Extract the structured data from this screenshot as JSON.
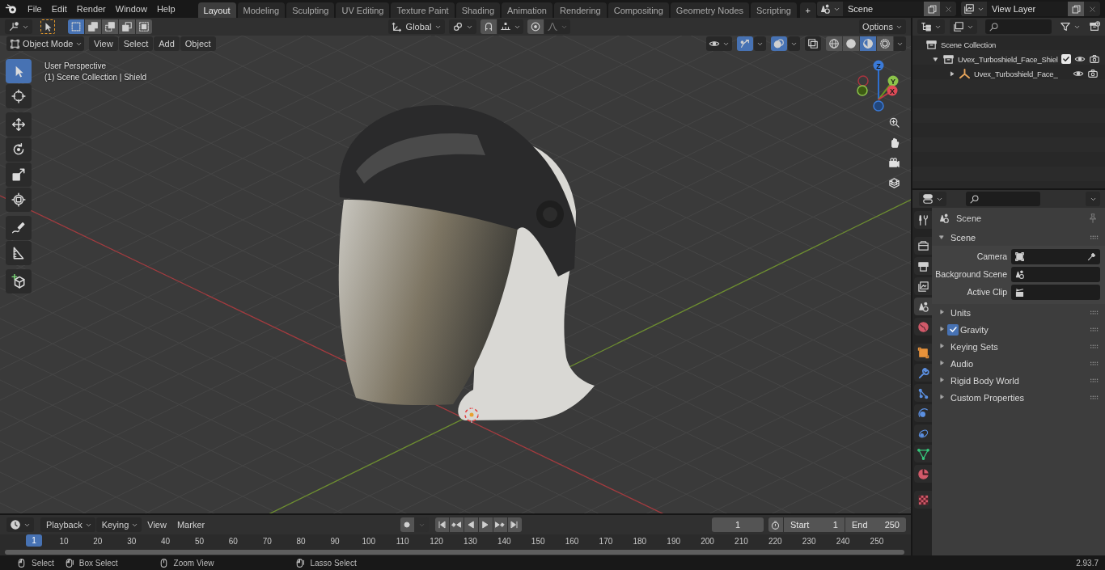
{
  "topbar": {
    "menus": [
      "File",
      "Edit",
      "Render",
      "Window",
      "Help"
    ],
    "workspaces": [
      {
        "label": "Layout",
        "selected": true
      },
      {
        "label": "Modeling",
        "selected": false
      },
      {
        "label": "Sculpting",
        "selected": false
      },
      {
        "label": "UV Editing",
        "selected": false
      },
      {
        "label": "Texture Paint",
        "selected": false
      },
      {
        "label": "Shading",
        "selected": false
      },
      {
        "label": "Animation",
        "selected": false
      },
      {
        "label": "Rendering",
        "selected": false
      },
      {
        "label": "Compositing",
        "selected": false
      },
      {
        "label": "Geometry Nodes",
        "selected": false
      },
      {
        "label": "Scripting",
        "selected": false
      }
    ],
    "add_workspace": "+",
    "scene": "Scene",
    "view_layer": "View Layer"
  },
  "viewport": {
    "header": {
      "selection_modes": [
        {
          "kind": "set",
          "selected": true
        },
        {
          "kind": "extend",
          "selected": false
        },
        {
          "kind": "subtract",
          "selected": false
        },
        {
          "kind": "difference",
          "selected": false
        },
        {
          "kind": "intersect",
          "selected": false
        }
      ],
      "orientation": "Global",
      "options": "Options",
      "mode": "Object Mode",
      "menus": [
        "View",
        "Select",
        "Add",
        "Object"
      ],
      "toggles": [
        {
          "kind": "gizmos",
          "on": true
        },
        {
          "kind": "overlays",
          "on": true
        },
        {
          "kind": "xray",
          "on": false
        }
      ],
      "shading_modes": [
        {
          "kind": "wireframe",
          "selected": false
        },
        {
          "kind": "solid",
          "selected": false
        },
        {
          "kind": "material",
          "selected": true
        },
        {
          "kind": "rendered",
          "selected": false
        }
      ]
    },
    "overlay_text": [
      "User Perspective",
      "(1) Scene Collection | Shield"
    ],
    "tools": [
      {
        "kind": "select",
        "selected": true
      },
      {
        "kind": "cursor",
        "selected": false
      },
      {
        "kind": "move",
        "selected": false
      },
      {
        "kind": "rotate",
        "selected": false
      },
      {
        "kind": "scale",
        "selected": false
      },
      {
        "kind": "transform",
        "selected": false
      },
      {
        "kind": "annotate",
        "selected": false
      },
      {
        "kind": "measure",
        "selected": false
      },
      {
        "kind": "add_cube",
        "selected": false
      }
    ],
    "gizmo_axes": [
      "X",
      "Y",
      "Z"
    ]
  },
  "outliner": {
    "items": [
      {
        "kind": "scene_collection",
        "label": "Scene Collection",
        "children": [
          {
            "kind": "collection",
            "label": "Uvex_Turboshield_Face_Shiel",
            "expanded": true,
            "checked": true,
            "children": [
              {
                "kind": "empty",
                "label": "Uvex_Turboshield_Face_",
                "expanded": false
              }
            ]
          }
        ]
      }
    ]
  },
  "properties": {
    "tabs": [
      {
        "kind": "tool",
        "selected": false
      },
      {
        "kind": "render",
        "selected": false
      },
      {
        "kind": "output",
        "selected": false
      },
      {
        "kind": "view_layer",
        "selected": false
      },
      {
        "kind": "scene",
        "selected": true
      },
      {
        "kind": "world",
        "selected": false
      },
      {
        "kind": "object",
        "selected": false
      },
      {
        "kind": "modifiers",
        "selected": false
      },
      {
        "kind": "particles",
        "selected": false
      },
      {
        "kind": "physics",
        "selected": false
      },
      {
        "kind": "constraints",
        "selected": false
      },
      {
        "kind": "data",
        "selected": false
      },
      {
        "kind": "material",
        "selected": false
      },
      {
        "kind": "texture",
        "selected": false
      }
    ],
    "context": "Scene",
    "panels": [
      {
        "kind": "panel",
        "label": "Scene",
        "expanded": true,
        "fields": [
          {
            "kind": "camera",
            "label": "Camera"
          },
          {
            "kind": "scene",
            "label": "Background Scene"
          },
          {
            "kind": "clip",
            "label": "Active Clip"
          }
        ]
      },
      {
        "kind": "panel",
        "label": "Units",
        "expanded": false
      },
      {
        "kind": "checkbox_panel",
        "label": "Gravity",
        "expanded": false,
        "checked": true
      },
      {
        "kind": "panel",
        "label": "Keying Sets",
        "expanded": false
      },
      {
        "kind": "panel",
        "label": "Audio",
        "expanded": false
      },
      {
        "kind": "panel",
        "label": "Rigid Body World",
        "expanded": false
      },
      {
        "kind": "panel",
        "label": "Custom Properties",
        "expanded": false
      }
    ]
  },
  "timeline": {
    "menus": [
      {
        "kind": "dropdown",
        "label": "Playback"
      },
      {
        "kind": "dropdown",
        "label": "Keying"
      },
      {
        "kind": "menu",
        "label": "View"
      },
      {
        "kind": "menu",
        "label": "Marker"
      }
    ],
    "current_frame": "1",
    "start_label": "Start",
    "start": "1",
    "end_label": "End",
    "end": "250",
    "playhead": "1",
    "ticks": [
      "10",
      "20",
      "30",
      "40",
      "50",
      "60",
      "70",
      "80",
      "90",
      "100",
      "110",
      "120",
      "130",
      "140",
      "150",
      "160",
      "170",
      "180",
      "190",
      "200",
      "210",
      "220",
      "230",
      "240",
      "250"
    ]
  },
  "status_bar": {
    "hints": [
      "Select",
      "Box Select",
      "Zoom View",
      "Lasso Select"
    ],
    "version": "2.93.7"
  }
}
